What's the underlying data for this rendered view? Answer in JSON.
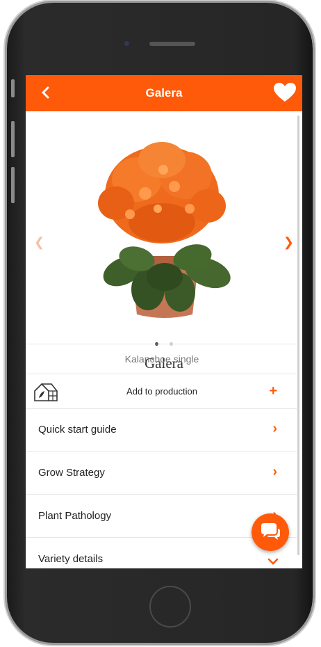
{
  "header": {
    "title": "Galera"
  },
  "product": {
    "name": "Galera",
    "subtitle": "Kalanchoe single",
    "image_alt": "orange kalanchoe in pot",
    "carousel_index": 1,
    "carousel_count": 2
  },
  "actions": {
    "add_to_production": "Add to production"
  },
  "menu": [
    {
      "label": "Quick start guide"
    },
    {
      "label": "Grow Strategy"
    },
    {
      "label": "Plant Pathology"
    },
    {
      "label": "Variety details"
    }
  ],
  "icons": {
    "back": "chevron-left-icon",
    "favorite": "heart-icon",
    "greenhouse": "greenhouse-icon",
    "chat": "chat-icon"
  },
  "colors": {
    "accent": "#ff5a0a",
    "flower": "#f26a1b",
    "pot": "#c57755",
    "leaf": "#3f5f2a"
  }
}
